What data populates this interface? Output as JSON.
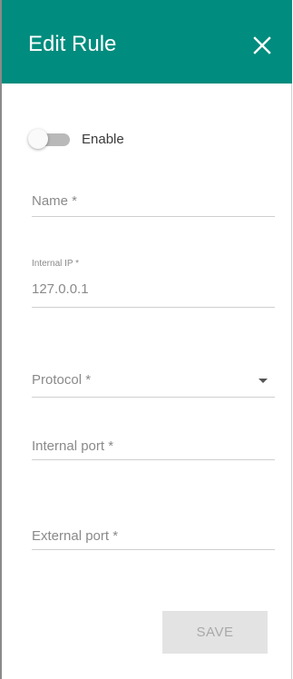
{
  "header": {
    "title": "Edit Rule",
    "close_icon": "close-icon",
    "color": "#008c7e"
  },
  "enable_toggle": {
    "label": "Enable",
    "checked": false
  },
  "fields": {
    "name": {
      "placeholder": "Name *",
      "value": ""
    },
    "internal_ip": {
      "label": "Internal IP *",
      "value": "127.0.0.1"
    },
    "protocol": {
      "placeholder": "Protocol *",
      "value": ""
    },
    "internal_port": {
      "placeholder": "Internal port *",
      "value": ""
    },
    "external_port": {
      "placeholder": "External port *",
      "value": ""
    }
  },
  "actions": {
    "save_label": "SAVE",
    "save_disabled": true
  }
}
